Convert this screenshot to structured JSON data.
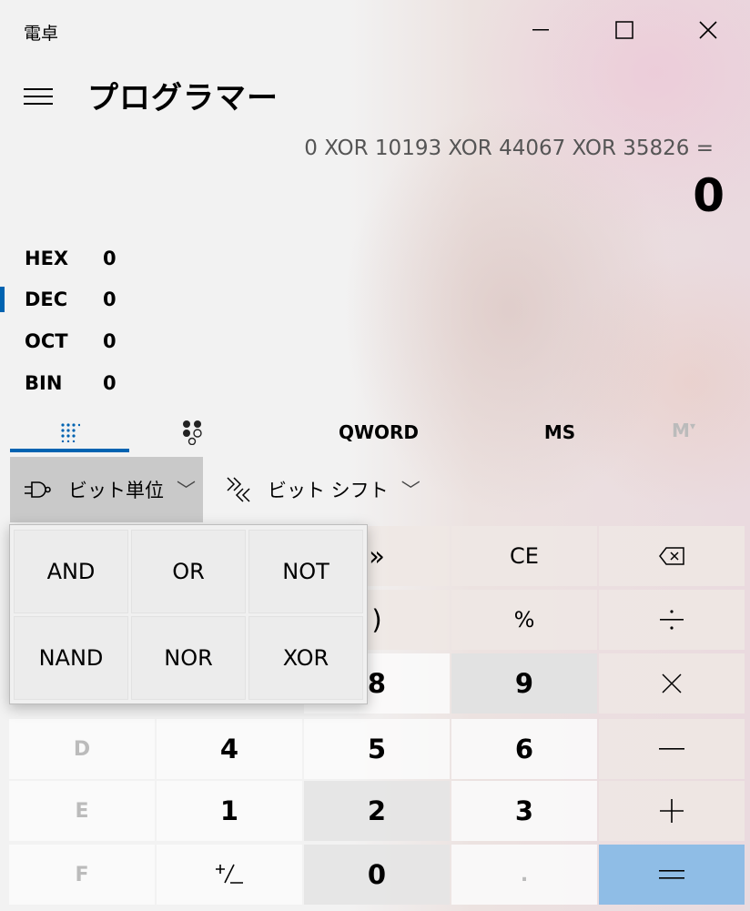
{
  "window": {
    "title": "電卓"
  },
  "header": {
    "mode": "プログラマー"
  },
  "display": {
    "expression": "0 XOR 10193 XOR 44067 XOR 35826 =",
    "result": "0"
  },
  "radix": [
    {
      "name": "HEX",
      "value": "0",
      "active": false
    },
    {
      "name": "DEC",
      "value": "0",
      "active": true
    },
    {
      "name": "OCT",
      "value": "0",
      "active": false
    },
    {
      "name": "BIN",
      "value": "0",
      "active": false
    }
  ],
  "tabs": {
    "word_size": "QWORD",
    "memory_store": "MS",
    "memory_recall": "M"
  },
  "toolbar": {
    "bitwise": "ビット単位",
    "bitshift": "ビット シフト"
  },
  "keys": {
    "shift": "»",
    "ce": "CE",
    "percent": "%",
    "paren_close": ")",
    "eight": "8",
    "nine": "9",
    "d": "D",
    "four": "4",
    "five": "5",
    "six": "6",
    "e": "E",
    "one": "1",
    "two": "2",
    "three": "3",
    "f": "F",
    "zero": "0",
    "decimal": "."
  },
  "bitwise_menu": [
    "AND",
    "OR",
    "NOT",
    "NAND",
    "NOR",
    "XOR"
  ],
  "colors": {
    "accent": "#0063b1",
    "equals": "#8fbde6"
  }
}
